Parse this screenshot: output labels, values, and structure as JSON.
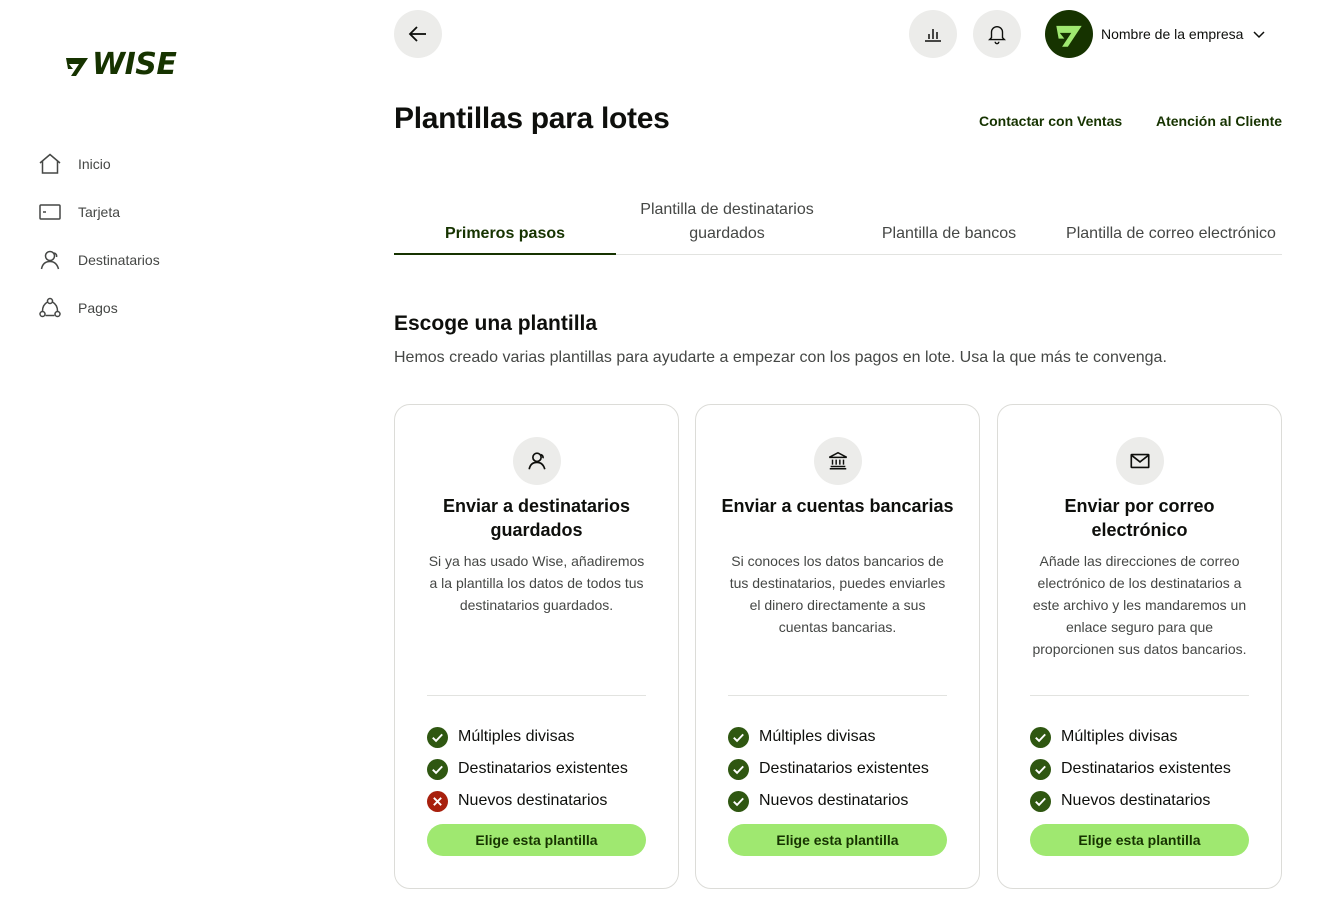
{
  "brand": {
    "name": "WISE",
    "accent": "#9fe870",
    "forest": "#163300"
  },
  "sidebar": {
    "items": [
      {
        "label": "Inicio",
        "icon": "home-icon"
      },
      {
        "label": "Tarjeta",
        "icon": "card-icon"
      },
      {
        "label": "Destinatarios",
        "icon": "recipients-icon"
      },
      {
        "label": "Pagos",
        "icon": "payments-icon"
      }
    ]
  },
  "topbar": {
    "back_icon": "arrow-left-icon",
    "insights_icon": "bar-chart-icon",
    "notifications_icon": "bell-icon",
    "account_name": "Nombre de la empresa",
    "dropdown_icon": "chevron-down-icon"
  },
  "header": {
    "title": "Plantillas para lotes",
    "links": [
      "Contactar con Ventas",
      "Atención al Cliente"
    ]
  },
  "tabs": [
    {
      "label": "Primeros pasos",
      "active": true
    },
    {
      "label": "Plantilla de destinatarios guardados",
      "active": false
    },
    {
      "label": "Plantilla de bancos",
      "active": false
    },
    {
      "label": "Plantilla de correo electrónico",
      "active": false
    }
  ],
  "section": {
    "title": "Escoge una plantilla",
    "description": "Hemos creado varias plantillas para ayudarte a empezar con los pagos en lote. Usa la que más te convenga."
  },
  "cards": [
    {
      "icon": "recipients-icon",
      "title": "Enviar a destinatarios guardados",
      "description": "Si ya has usado Wise, añadiremos a la plantilla los datos de todos tus destinatarios guardados.",
      "features": [
        {
          "label": "Múltiples divisas",
          "status": "check"
        },
        {
          "label": "Destinatarios existentes",
          "status": "check"
        },
        {
          "label": "Nuevos destinatarios",
          "status": "cross"
        }
      ],
      "button": "Elige esta plantilla"
    },
    {
      "icon": "bank-icon",
      "title": "Enviar a cuentas bancarias",
      "description": "Si conoces los datos bancarios de tus destinatarios, puedes enviarles el dinero directamente a sus cuentas bancarias.",
      "features": [
        {
          "label": "Múltiples divisas",
          "status": "check"
        },
        {
          "label": "Destinatarios existentes",
          "status": "check"
        },
        {
          "label": "Nuevos destinatarios",
          "status": "check"
        }
      ],
      "button": "Elige esta plantilla"
    },
    {
      "icon": "envelope-icon",
      "title": "Enviar por correo electrónico",
      "description": "Añade las direcciones de correo electrónico de los destinatarios a este archivo y les mandaremos un enlace seguro para que proporcionen sus datos bancarios.",
      "features": [
        {
          "label": "Múltiples divisas",
          "status": "check"
        },
        {
          "label": "Destinatarios existentes",
          "status": "check"
        },
        {
          "label": "Nuevos destinatarios",
          "status": "check"
        }
      ],
      "button": "Elige esta plantilla"
    }
  ]
}
